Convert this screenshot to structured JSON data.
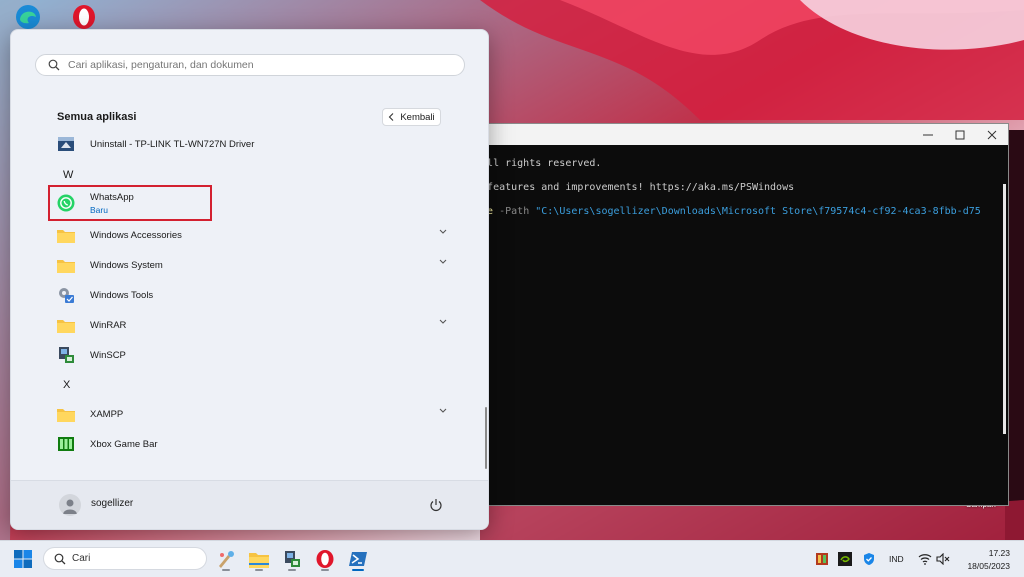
{
  "start_menu": {
    "search_placeholder": "Cari aplikasi, pengaturan, dan dokumen",
    "section_title": "Semua aplikasi",
    "back_label": "Kembali",
    "items": [
      {
        "label": "Uninstall - TP-LINK TL-WN727N Driver",
        "icon": "installer-icon"
      },
      {
        "label": "WhatsApp",
        "sub": "Baru",
        "icon": "whatsapp-icon"
      },
      {
        "label": "Windows Accessories",
        "icon": "folder-icon",
        "expandable": true
      },
      {
        "label": "Windows System",
        "icon": "folder-icon",
        "expandable": true
      },
      {
        "label": "Windows Tools",
        "icon": "windows-tools-icon"
      },
      {
        "label": "WinRAR",
        "icon": "folder-icon",
        "expandable": true
      },
      {
        "label": "WinSCP",
        "icon": "winscp-icon"
      },
      {
        "label": "XAMPP",
        "icon": "folder-icon",
        "expandable": true
      },
      {
        "label": "Xbox Game Bar",
        "icon": "xbox-game-bar-icon"
      }
    ],
    "letters": [
      "W",
      "X"
    ],
    "user_name": "sogellizer"
  },
  "terminal": {
    "line1": ". All rights reserved.",
    "line2": "ew features and improvements! https://aka.ms/PSWindows",
    "line3_cmd": "kage",
    "line3_param": " -Path ",
    "line3_str": "\"C:\\Users\\sogellizer\\Downloads\\Microsoft Store\\f79574c4-cf92-4ca3-8fbb-d75"
  },
  "taskbar": {
    "search_label": "Cari",
    "language": "IND",
    "time": "17.23",
    "date": "18/05/2023"
  },
  "desktop": {
    "recycle_bin_label": "Sampah"
  },
  "colors": {
    "accent": "#0067c0",
    "highlight_box": "#d32030",
    "whatsapp": "#25d366",
    "folder": "#f6c343"
  }
}
